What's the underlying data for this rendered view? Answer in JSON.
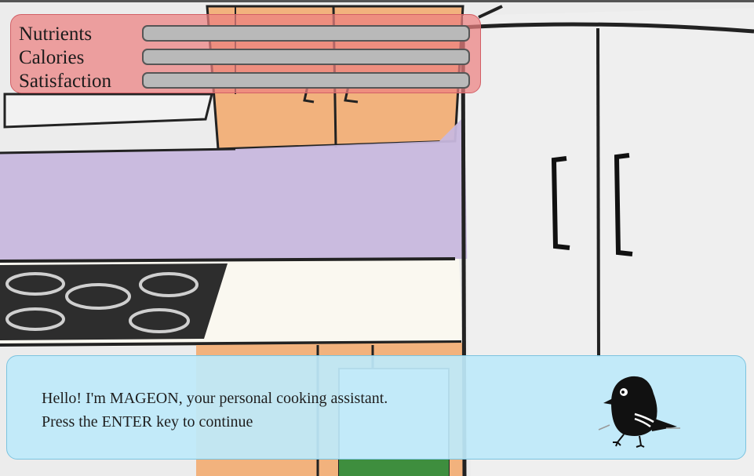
{
  "stats": [
    {
      "label": "Nutrients",
      "level": 0
    },
    {
      "label": "Calories",
      "level": 0
    },
    {
      "label": "Satisfaction",
      "level": 0
    }
  ],
  "dialog": {
    "line1": "Hello! I'm MAGEON, your personal cooking assistant.",
    "line2": "Press the ENTER key to continue"
  },
  "colors": {
    "stats_panel": "#ec8080",
    "stat_bar_track": "#b9b9b9",
    "dialog_panel": "#beeafa",
    "countertop": "#c8b8de",
    "cabinet": "#f2b27d",
    "stovetop": "#2d2d2d"
  },
  "icons": {
    "assistant": "mageon-bird-icon"
  }
}
